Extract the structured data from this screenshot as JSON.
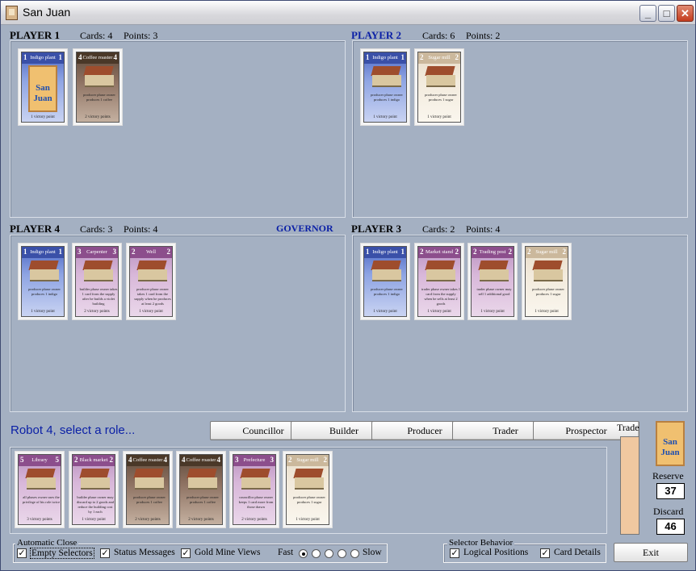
{
  "window": {
    "title": "San Juan",
    "minimize": "_",
    "maximize": "□",
    "close": "✕"
  },
  "players": {
    "p1": {
      "name": "PLAYER 1",
      "cards": "Cards:  4",
      "points": "Points: 3"
    },
    "p2": {
      "name": "PLAYER 2",
      "cards": "Cards:  6",
      "points": "Points: 2"
    },
    "p4": {
      "name": "PLAYER 4",
      "cards": "Cards:  3",
      "points": "Points: 4"
    },
    "p3": {
      "name": "PLAYER 3",
      "cards": "Cards:  2",
      "points": "Points: 4"
    }
  },
  "governor": "GOVERNOR",
  "cards": {
    "p1_1": {
      "cost_l": "1",
      "cost_r": "1",
      "title": "Indigo plant",
      "text": "producer phase owner produces 1 indigo",
      "vp": "1 victory point",
      "logo": "San Juan"
    },
    "p1_2": {
      "cost_l": "4",
      "cost_r": "4",
      "title": "Coffee roaster",
      "text": "producer phase owner produces 1 coffee",
      "vp": "2 victory points"
    },
    "p2_1": {
      "cost_l": "1",
      "cost_r": "1",
      "title": "Indigo plant",
      "text": "producer phase owner produces 1 indigo",
      "vp": "1 victory point"
    },
    "p2_2": {
      "cost_l": "2",
      "cost_r": "2",
      "title": "Sugar mill",
      "text": "producer phase owner produces 1 sugar",
      "vp": "1 victory point"
    },
    "p4_1": {
      "cost_l": "1",
      "cost_r": "1",
      "title": "Indigo plant",
      "text": "producer phase owner produces 1 indigo",
      "vp": "1 victory point"
    },
    "p4_2": {
      "cost_l": "3",
      "cost_r": "3",
      "title": "Carpenter",
      "text": "builder phase owner takes 1 card from the supply after he builds a violet building",
      "vp": "2 victory points"
    },
    "p4_3": {
      "cost_l": "2",
      "cost_r": "2",
      "title": "Well",
      "text": "producer phase owner takes 1 card from the supply when he produces at least 2 goods",
      "vp": "1 victory point"
    },
    "p3_1": {
      "cost_l": "1",
      "cost_r": "1",
      "title": "Indigo plant",
      "text": "producer phase owner produces 1 indigo",
      "vp": "1 victory point"
    },
    "p3_2": {
      "cost_l": "2",
      "cost_r": "2",
      "title": "Market stand",
      "text": "trader phase owner takes 1 card from the supply when he sells at least 2 goods",
      "vp": "1 victory point"
    },
    "p3_3": {
      "cost_l": "2",
      "cost_r": "2",
      "title": "Trading post",
      "text": "trader phase owner may sell 1 additional good",
      "vp": "1 victory point"
    },
    "p3_4": {
      "cost_l": "2",
      "cost_r": "2",
      "title": "Sugar mill",
      "text": "producer phase owner produces 1 sugar",
      "vp": "1 victory point"
    },
    "h_1": {
      "cost_l": "5",
      "cost_r": "5",
      "title": "Library",
      "text": "all phases owner uses the privilege of his role twice",
      "vp": "3 victory points"
    },
    "h_2": {
      "cost_l": "2",
      "cost_r": "2",
      "title": "Black market",
      "text": "builder phase owner may discard up to 2 goods and reduce the building cost by 1 each",
      "vp": "1 victory point"
    },
    "h_3": {
      "cost_l": "4",
      "cost_r": "4",
      "title": "Coffee roaster",
      "text": "producer phase owner produces 1 coffee",
      "vp": "2 victory points"
    },
    "h_4": {
      "cost_l": "4",
      "cost_r": "4",
      "title": "Coffee roaster",
      "text": "producer phase owner produces 1 coffee",
      "vp": "2 victory points"
    },
    "h_5": {
      "cost_l": "3",
      "cost_r": "3",
      "title": "Prefecture",
      "text": "councillor phase owner keeps 1 card more from those drawn",
      "vp": "2 victory points"
    },
    "h_6": {
      "cost_l": "2",
      "cost_r": "2",
      "title": "Sugar mill",
      "text": "producer phase owner produces 1 sugar",
      "vp": "1 victory point"
    }
  },
  "status": "Robot 4, select a role...",
  "roles": [
    "Councillor",
    "Builder",
    "Producer",
    "Trader",
    "Prospector"
  ],
  "side": {
    "trade": "Trade",
    "logo": "San Juan",
    "reserve_label": "Reserve",
    "reserve": "37",
    "discard_label": "Discard",
    "discard": "46"
  },
  "auto_close": {
    "label": "Automatic Close",
    "empty_selectors": "Empty Selectors",
    "status_messages": "Status Messages",
    "gold_mine_views": "Gold Mine Views",
    "fast": "Fast",
    "slow": "Slow"
  },
  "selector": {
    "label": "Selector Behavior",
    "logical_positions": "Logical Positions",
    "card_details": "Card Details"
  },
  "exit": "Exit",
  "check": "✓",
  "colors": {
    "background": "#a4b0c2",
    "accent_blue": "#0a1fa6",
    "trade_box": "#f0c8a0"
  }
}
